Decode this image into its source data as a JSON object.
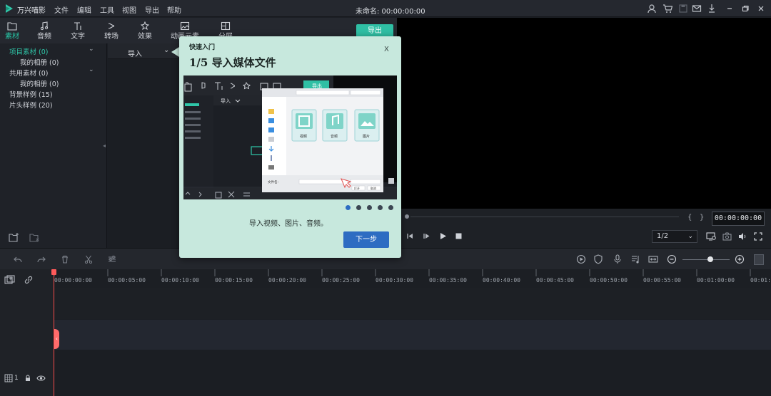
{
  "app": {
    "name": "万兴喵影",
    "menus": [
      "文件",
      "编辑",
      "工具",
      "视图",
      "导出",
      "帮助"
    ],
    "document_title": "未命名: 00:00:00:00"
  },
  "toolbar": {
    "tabs": [
      {
        "label": "素材",
        "icon": "folder-icon"
      },
      {
        "label": "音频",
        "icon": "music-note-icon"
      },
      {
        "label": "文字",
        "icon": "text-icon"
      },
      {
        "label": "转场",
        "icon": "transition-icon"
      },
      {
        "label": "效果",
        "icon": "effects-icon"
      },
      {
        "label": "动画元素",
        "icon": "elements-icon"
      },
      {
        "label": "分屏",
        "icon": "split-screen-icon"
      }
    ],
    "export_label": "导出"
  },
  "library": {
    "items": [
      {
        "label": "项目素材 (0)",
        "active": true,
        "expandable": true
      },
      {
        "label": "我的相册 (0)",
        "child": true
      },
      {
        "label": "共用素材 (0)",
        "expandable": true
      },
      {
        "label": "我的相册 (0)",
        "child": true
      },
      {
        "label": "背景样例 (15)"
      },
      {
        "label": "片头样例 (20)"
      }
    ],
    "import_label": "导入"
  },
  "player": {
    "timecode": "00:00:00:00",
    "ratio": "1/2"
  },
  "timeline": {
    "ticks": [
      "00:00:00:00",
      "00:00:05:00",
      "00:00:10:00",
      "00:00:15:00",
      "00:00:20:00",
      "00:00:25:00",
      "00:00:30:00",
      "00:00:35:00",
      "00:00:40:00",
      "00:00:45:00",
      "00:00:50:00",
      "00:00:55:00",
      "00:01:00:00",
      "00:01:05:00"
    ],
    "track_label": "1"
  },
  "dialog": {
    "kicker": "快速入门",
    "title": "1/5 导入媒体文件",
    "close": "X",
    "description": "导入视频、图片、音频。",
    "next_label": "下一步",
    "step": 1,
    "steps_total": 5,
    "preview": {
      "export_label": "导出",
      "import_label": "导入",
      "file_types": [
        "视频",
        "音频",
        "图片"
      ],
      "filename_label": "文件名:",
      "open_label": "打开",
      "cancel_label": "取消"
    }
  },
  "colors": {
    "accent": "#2fc7a9",
    "dialog_bg": "#c7e8dd",
    "primary_button": "#2d6cc2",
    "playhead": "#ff5a5a"
  }
}
